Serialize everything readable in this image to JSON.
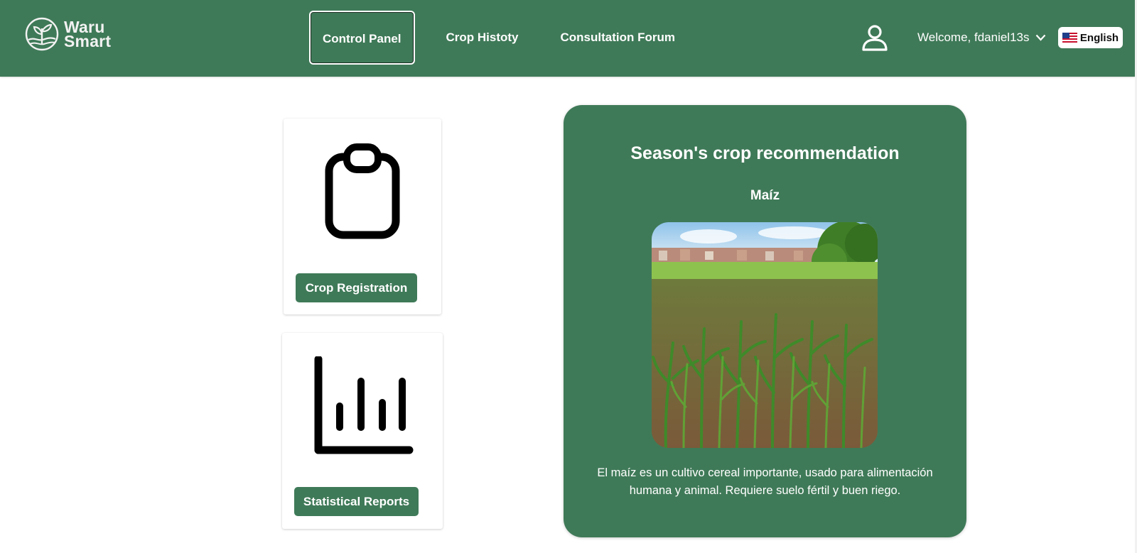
{
  "brand": {
    "line1": "Waru",
    "line2": "Smart",
    "logo_icon": "sprout-in-circle-icon"
  },
  "nav": {
    "items": [
      {
        "label": "Control Panel",
        "active": true
      },
      {
        "label": "Crop Histoty",
        "active": false
      },
      {
        "label": "Consultation Forum",
        "active": false
      }
    ]
  },
  "user": {
    "icon": "user-icon",
    "welcome": "Welcome, fdaniel13s",
    "dropdown_icon": "chevron-down-icon"
  },
  "language": {
    "label": "English",
    "flag_icon": "us-flag-icon"
  },
  "cards": [
    {
      "icon": "clipboard-icon",
      "button": "Crop Registration"
    },
    {
      "icon": "bar-chart-icon",
      "button": "Statistical Reports"
    }
  ],
  "recommendation": {
    "title": "Season's crop recommendation",
    "crop": "Maíz",
    "image": "corn-field-photo",
    "description": "El maíz es un cultivo cereal importante, usado para alimentación humana y animal. Requiere suelo fértil y buen riego."
  },
  "colors": {
    "primary": "#3f7a58",
    "background": "#ffffff",
    "text_light": "#ffffff"
  }
}
